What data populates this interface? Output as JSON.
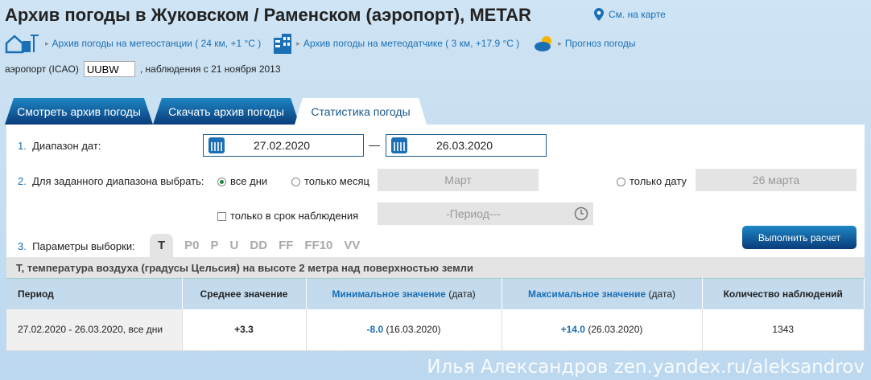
{
  "title": "Архив погоды в Жуковском / Раменском (аэропорт), METAR",
  "map_link": "См. на карте",
  "links": [
    "Архив погоды на метеостанции ( 24 км, +1 °C )",
    "Архив погоды на метеодатчике ( 3 км, +17.9 °C )",
    "Прогноз погоды"
  ],
  "icao": {
    "label": "аэропорт (ICAO)",
    "value": "UUBW",
    "since": ", наблюдения с 21 ноября 2013"
  },
  "tabs": [
    "Смотреть архив погоды",
    "Скачать архив погоды",
    "Статистика погоды"
  ],
  "form": {
    "n1": "1.",
    "range_label": "Диапазон дат:",
    "date_from": "27.02.2020",
    "dash": "—",
    "date_to": "26.03.2020",
    "n2": "2.",
    "select_label": "Для заданного диапазона выбрать:",
    "all_days": "все дни",
    "only_month": "только месяц",
    "month_value": "Март",
    "only_date": "только дату",
    "date_value": "26 марта",
    "only_obs": "только в срок наблюдения",
    "period_placeholder": "-Период---",
    "n3": "3.",
    "params_label": "Параметры выборки:",
    "params": [
      "T",
      "P0",
      "P",
      "U",
      "DD",
      "FF",
      "FF10",
      "VV"
    ],
    "run": "Выполнить расчет"
  },
  "description": "T, температура воздуха (градусы Цельсия) на высоте 2 метра над поверхностью земли",
  "table": {
    "headers": {
      "period": "Период",
      "avg": "Среднее значение",
      "min": "Минимальное значение",
      "max": "Максимальное значение",
      "date_suffix": " (дата)",
      "count": "Количество наблюдений"
    },
    "row": {
      "period": "27.02.2020 - 26.03.2020, все дни",
      "avg": "+3.3",
      "min": "-8.0",
      "min_date": " (16.03.2020)",
      "max": "+14.0",
      "max_date": " (26.03.2020)",
      "count": "1343"
    }
  },
  "watermark": "Илья Александров zen.yandex.ru/aleksandrov"
}
